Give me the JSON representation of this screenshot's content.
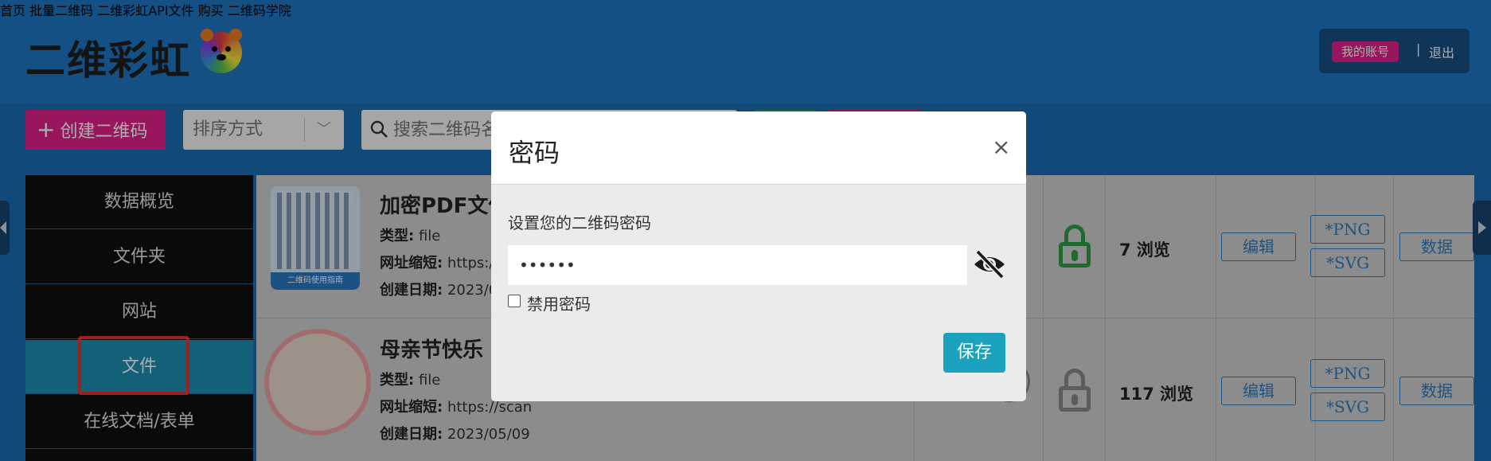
{
  "header": {
    "logo": "二维彩虹",
    "nav": [
      "首页",
      "批量二维码",
      "二维彩虹API文件",
      "购买",
      "二维码学院"
    ],
    "account_button": "我的账号",
    "separator": "|",
    "logout": "退出"
  },
  "toolbar": {
    "create_label": "创建二维码",
    "sort_label": "排序方式",
    "search_placeholder": "搜索二维码名"
  },
  "sidebar": {
    "items": [
      {
        "label": "数据概览"
      },
      {
        "label": "文件夹"
      },
      {
        "label": "网站"
      },
      {
        "label": "文件"
      },
      {
        "label": "在线文档/表单"
      }
    ],
    "active_index": 3
  },
  "list": {
    "rows": [
      {
        "title": "加密PDF文件",
        "type_label": "类型:",
        "type_value": "file",
        "short_label": "网址缩短:",
        "short_value": "https:/",
        "date_label": "创建日期:",
        "date_value": "2023/0",
        "thumb_caption": "二维码使用指南",
        "views": "7 浏览",
        "lock_color": "#2f9e44",
        "edit": "编辑",
        "png": "*PNG",
        "svg": "*SVG",
        "data": "数据"
      },
      {
        "title": "母亲节快乐",
        "type_label": "类型:",
        "type_value": "file",
        "short_label": "网址缩短:",
        "short_value": "https://scan",
        "date_label": "创建日期:",
        "date_value": "2023/05/09",
        "views": "117 浏览",
        "lock_color": "#888888",
        "edit": "编辑",
        "png": "*PNG",
        "svg": "*SVG",
        "data": "数据"
      }
    ]
  },
  "modal": {
    "title": "密码",
    "close": "×",
    "label": "设置您的二维码密码",
    "password_value": "••••••",
    "disable_label": "禁用密码",
    "save": "保存"
  },
  "colors": {
    "header_bg": "#1f77c4",
    "accent_pink": "#e0218a",
    "active_teal": "#1d8fb3",
    "save_btn": "#1ba2be",
    "highlight_red": "#e8312a"
  }
}
